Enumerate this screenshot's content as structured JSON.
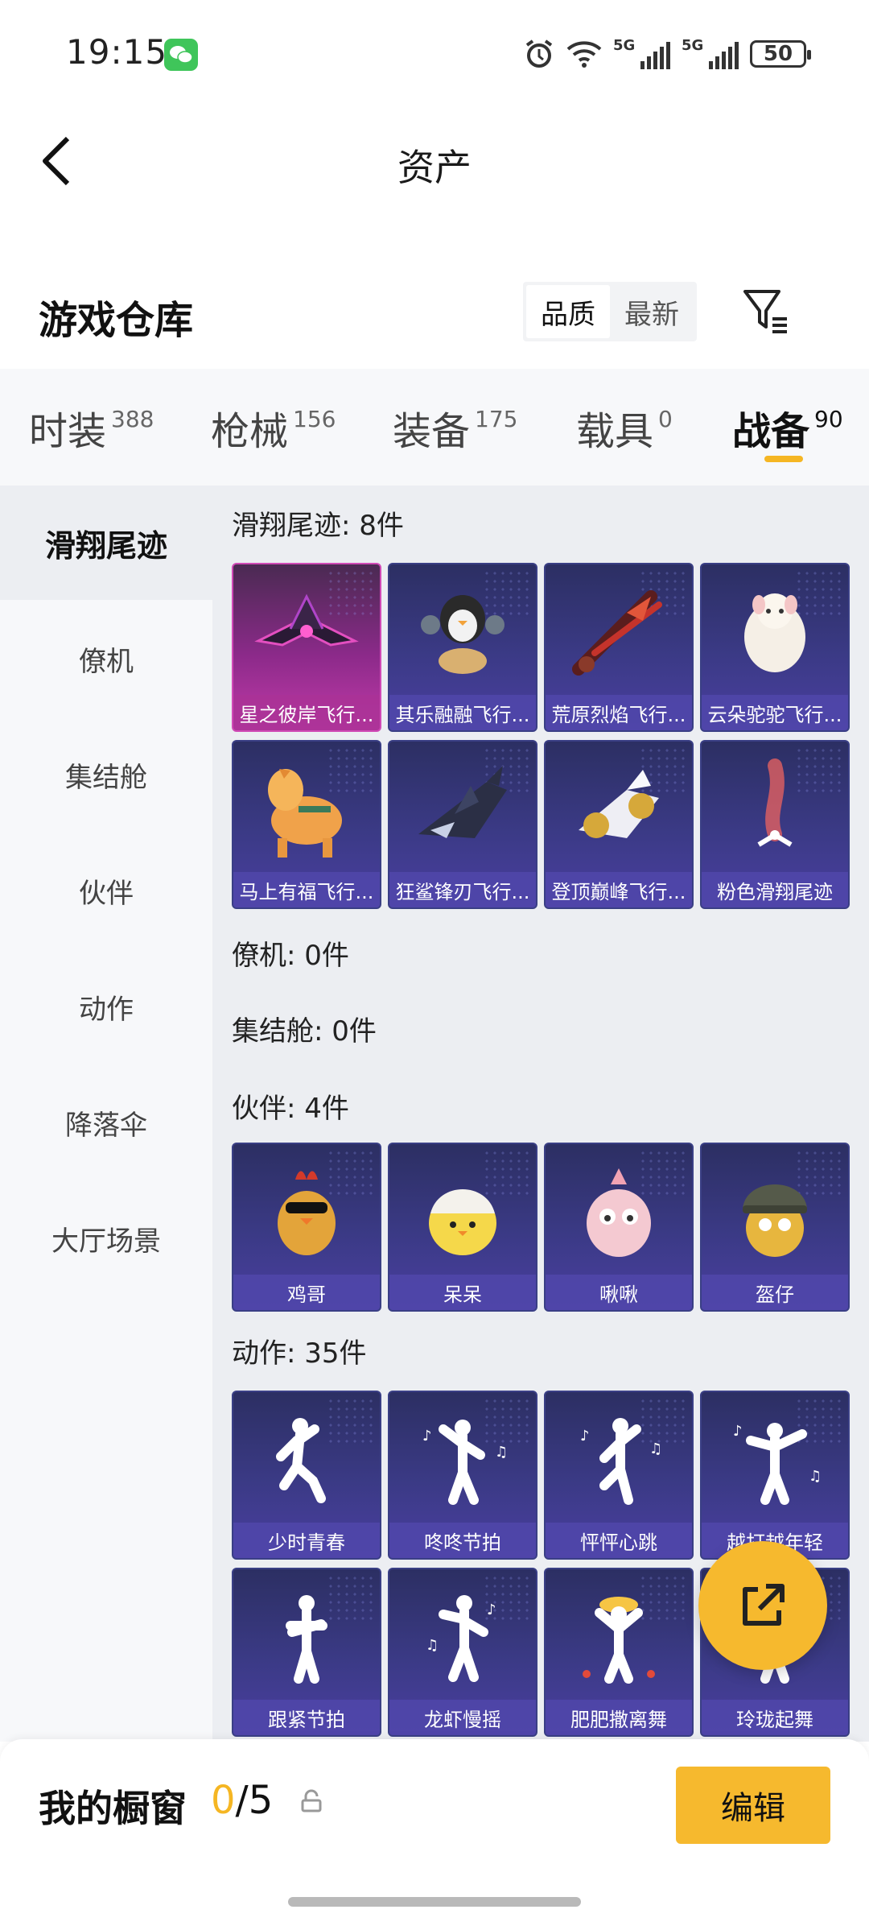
{
  "status_bar": {
    "time": "19:15",
    "signal_label_1": "5G",
    "signal_label_2": "5G",
    "battery": "50",
    "icons": [
      "wechat-icon",
      "alarm-icon",
      "wifi-icon",
      "signal-icon",
      "battery-icon"
    ]
  },
  "header": {
    "title": "资产",
    "back_icon": "chevron-left-icon"
  },
  "warehouse": {
    "title": "游戏仓库",
    "sort_options": [
      "品质",
      "最新"
    ],
    "sort_selected": "品质",
    "filter_icon": "filter-icon"
  },
  "tabs": [
    {
      "label": "时装",
      "count": "388"
    },
    {
      "label": "枪械",
      "count": "156"
    },
    {
      "label": "装备",
      "count": "175"
    },
    {
      "label": "载具",
      "count": "0"
    },
    {
      "label": "战备",
      "count": "90"
    }
  ],
  "active_tab": "战备",
  "sidebar": {
    "items": [
      {
        "label": "滑翔尾迹"
      },
      {
        "label": "僚机"
      },
      {
        "label": "集结舱"
      },
      {
        "label": "伙伴"
      },
      {
        "label": "动作"
      },
      {
        "label": "降落伞"
      },
      {
        "label": "大厅场景"
      }
    ],
    "active": "滑翔尾迹"
  },
  "sections": [
    {
      "title": "滑翔尾迹: 8件",
      "items": [
        {
          "name": "星之彼岸飞行..."
        },
        {
          "name": "其乐融融飞行..."
        },
        {
          "name": "荒原烈焰飞行..."
        },
        {
          "name": "云朵驼驼飞行..."
        },
        {
          "name": "马上有福飞行..."
        },
        {
          "name": "狂鲨锋刃飞行..."
        },
        {
          "name": "登顶巅峰飞行..."
        },
        {
          "name": "粉色滑翔尾迹"
        }
      ]
    },
    {
      "title": "僚机: 0件",
      "items": []
    },
    {
      "title": "集结舱: 0件",
      "items": []
    },
    {
      "title": "伙伴: 4件",
      "items": [
        {
          "name": "鸡哥"
        },
        {
          "name": "呆呆"
        },
        {
          "name": "啾啾"
        },
        {
          "name": "盔仔"
        }
      ]
    },
    {
      "title": "动作: 35件",
      "items": [
        {
          "name": "少时青春"
        },
        {
          "name": "咚咚节拍"
        },
        {
          "name": "怦怦心跳"
        },
        {
          "name": "越打越年轻"
        },
        {
          "name": "跟紧节拍"
        },
        {
          "name": "龙虾慢摇"
        },
        {
          "name": "肥肥撒离舞"
        },
        {
          "name": "玲珑起舞"
        }
      ]
    }
  ],
  "fab": {
    "icon": "share-external-icon"
  },
  "bottom_bar": {
    "title": "我的橱窗",
    "count_current": "0",
    "count_total": "/5",
    "lock_icon": "lock-icon",
    "edit_label": "编辑"
  },
  "colors": {
    "accent": "#f6b92e",
    "card_bg": "#3b3a86",
    "card_highlight": "#c13aa8",
    "sidebar_bg": "#f7f8fa",
    "content_bg": "#eceef2"
  }
}
